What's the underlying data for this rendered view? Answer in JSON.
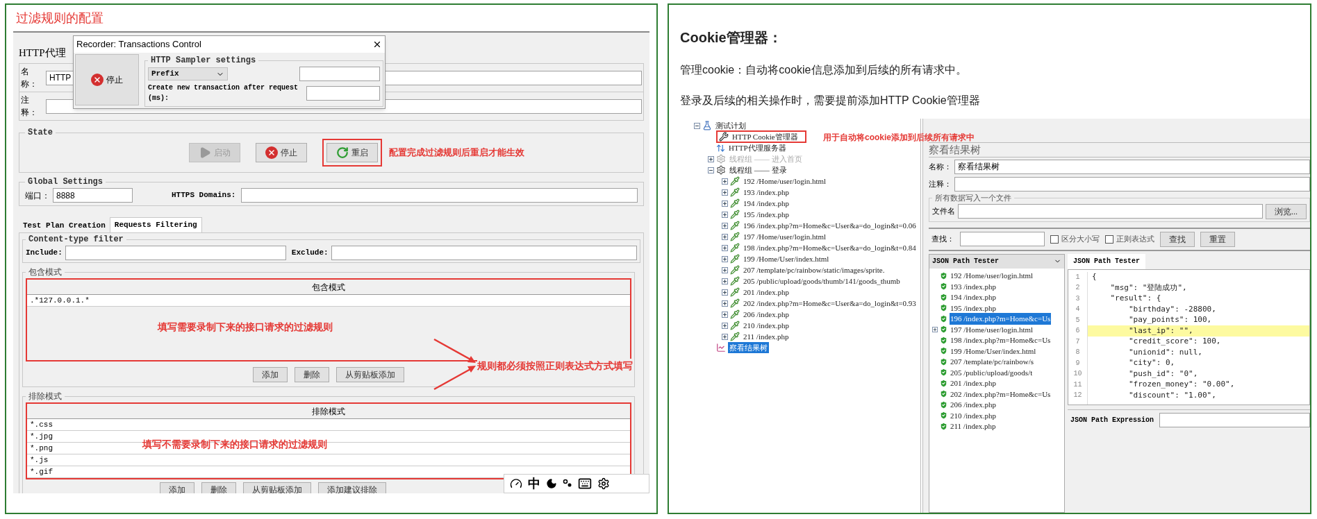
{
  "left": {
    "title": "过滤规则的配置",
    "proxy": {
      "heading": "HTTP代理",
      "name_label": "名称：",
      "name_value": "HTTP",
      "comment_label": "注释："
    },
    "dialog": {
      "title": "Recorder: Transactions Control",
      "stop_label": "停止",
      "group": "HTTP Sampler settings",
      "prefix": "Prefix",
      "transaction_label": "Create new transaction after request (ms):"
    },
    "state": {
      "legend": "State",
      "buttons": [
        {
          "kind": "start",
          "label": "启动",
          "disabled": true,
          "highlighted": false
        },
        {
          "kind": "stop",
          "label": "停止",
          "disabled": false,
          "highlighted": false
        },
        {
          "kind": "restart",
          "label": "重启",
          "disabled": false,
          "highlighted": true
        }
      ],
      "note": "配置完成过滤规则后重启才能生效"
    },
    "global": {
      "legend": "Global Settings",
      "port_label": "端口：",
      "port": "8888",
      "https_label": "HTTPS Domains:"
    },
    "tabs": [
      {
        "label": "Test Plan Creation",
        "selected": false
      },
      {
        "label": "Requests Filtering",
        "selected": true
      }
    ],
    "content_filter": {
      "legend": "Content-type filter",
      "include_label": "Include:",
      "exclude_label": "Exclude:"
    },
    "include": {
      "legend": "包含模式",
      "header": "包含模式",
      "rows": [
        ".*127.0.0.1.*"
      ],
      "note": "填写需要录制下来的接口请求的过滤规则",
      "buttons": [
        "添加",
        "删除",
        "从剪贴板添加"
      ]
    },
    "rule_note": "规则都必须按照正则表达式方式填写",
    "exclude": {
      "legend": "排除模式",
      "header": "排除模式",
      "rows": [
        "*.css",
        "*.jpg",
        "*.png",
        "*.js",
        "*.gif"
      ],
      "note": "填写不需要录制下来的接口请求的过滤规则",
      "buttons": [
        "添加",
        "删除",
        "从剪贴板添加",
        "添加建议排除"
      ]
    },
    "ime": {
      "mode": "中"
    }
  },
  "right": {
    "heading": "Cookie管理器：",
    "paragraphs": [
      "管理cookie：自动将cookie信息添加到后续的所有请求中。",
      "登录及后续的相关操作时，需要提前添加HTTP Cookie管理器"
    ],
    "tree_note": "用于自动将cookie添加到后续所有请求中",
    "tree": [
      {
        "kind": "plan",
        "label": "测试计划",
        "expanded": true,
        "disabled": false,
        "selected": false,
        "boxed": false,
        "children": [
          {
            "kind": "config",
            "label": "HTTP Cookie管理器",
            "disabled": false,
            "selected": false,
            "boxed": true
          },
          {
            "kind": "proxy",
            "label": "HTTP代理服务器",
            "disabled": false,
            "selected": false,
            "boxed": false
          },
          {
            "kind": "thread",
            "label": "线程组 —— 进入首页",
            "expanded": false,
            "disabled": true,
            "selected": false,
            "boxed": false
          },
          {
            "kind": "thread",
            "label": "线程组 —— 登录",
            "expanded": true,
            "disabled": false,
            "selected": false,
            "boxed": false,
            "children": [
              {
                "kind": "sampler",
                "label": "192 /Home/user/login.html",
                "expanded": false,
                "disabled": false,
                "selected": false,
                "boxed": false
              },
              {
                "kind": "sampler",
                "label": "193 /index.php",
                "expanded": false,
                "disabled": false,
                "selected": false,
                "boxed": false
              },
              {
                "kind": "sampler",
                "label": "194 /index.php",
                "expanded": false,
                "disabled": false,
                "selected": false,
                "boxed": false
              },
              {
                "kind": "sampler",
                "label": "195 /index.php",
                "expanded": false,
                "disabled": false,
                "selected": false,
                "boxed": false
              },
              {
                "kind": "sampler",
                "label": "196 /index.php?m=Home&c=User&a=do_login&t=0.06",
                "expanded": false,
                "disabled": false,
                "selected": false,
                "boxed": false
              },
              {
                "kind": "sampler",
                "label": "197 /Home/user/login.html",
                "expanded": false,
                "disabled": false,
                "selected": false,
                "boxed": false
              },
              {
                "kind": "sampler",
                "label": "198 /index.php?m=Home&c=User&a=do_login&t=0.84",
                "expanded": false,
                "disabled": false,
                "selected": false,
                "boxed": false
              },
              {
                "kind": "sampler",
                "label": "199 /Home/User/index.html",
                "expanded": false,
                "disabled": false,
                "selected": false,
                "boxed": false
              },
              {
                "kind": "sampler",
                "label": "207 /template/pc/rainbow/static/images/sprite.",
                "expanded": false,
                "disabled": false,
                "selected": false,
                "boxed": false
              },
              {
                "kind": "sampler",
                "label": "205 /public/upload/goods/thumb/141/goods_thumb",
                "expanded": false,
                "disabled": false,
                "selected": false,
                "boxed": false
              },
              {
                "kind": "sampler",
                "label": "201 /index.php",
                "expanded": false,
                "disabled": false,
                "selected": false,
                "boxed": false
              },
              {
                "kind": "sampler",
                "label": "202 /index.php?m=Home&c=User&a=do_login&t=0.93",
                "expanded": false,
                "disabled": false,
                "selected": false,
                "boxed": false
              },
              {
                "kind": "sampler",
                "label": "206 /index.php",
                "expanded": false,
                "disabled": false,
                "selected": false,
                "boxed": false
              },
              {
                "kind": "sampler",
                "label": "210 /index.php",
                "expanded": false,
                "disabled": false,
                "selected": false,
                "boxed": false
              },
              {
                "kind": "sampler",
                "label": "211 /index.php",
                "expanded": false,
                "disabled": false,
                "selected": false,
                "boxed": false
              }
            ]
          },
          {
            "kind": "listener",
            "label": "察看结果树",
            "disabled": false,
            "selected": true,
            "boxed": false
          }
        ]
      }
    ],
    "results": {
      "title": "察看结果树",
      "name_label": "名称：",
      "name_value": "察看结果树",
      "comment_label": "注释：",
      "file_group": "所有数据写入一个文件",
      "file_label": "文件名",
      "browse": "浏览...",
      "search_label": "查找：",
      "checkboxes": [
        {
          "label": "区分大小写",
          "checked": false
        },
        {
          "label": "正则表达式",
          "checked": false
        }
      ],
      "buttons": [
        "查找",
        "重置"
      ],
      "renderer": "JSON Path Tester",
      "items": [
        {
          "label": "192 /Home/user/login.html",
          "selected": false,
          "expandable": false
        },
        {
          "label": "193 /index.php",
          "selected": false,
          "expandable": false
        },
        {
          "label": "194 /index.php",
          "selected": false,
          "expandable": false
        },
        {
          "label": "195 /index.php",
          "selected": false,
          "expandable": false
        },
        {
          "label": "196 /index.php?m=Home&c=Us",
          "selected": true,
          "expandable": false
        },
        {
          "label": "197 /Home/user/login.html",
          "selected": false,
          "expandable": true
        },
        {
          "label": "198 /index.php?m=Home&c=Us",
          "selected": false,
          "expandable": false
        },
        {
          "label": "199 /Home/User/index.html",
          "selected": false,
          "expandable": false
        },
        {
          "label": "207 /template/pc/rainbow/s",
          "selected": false,
          "expandable": false
        },
        {
          "label": "205 /public/upload/goods/t",
          "selected": false,
          "expandable": false
        },
        {
          "label": "201 /index.php",
          "selected": false,
          "expandable": false
        },
        {
          "label": "202 /index.php?m=Home&c=Us",
          "selected": false,
          "expandable": false
        },
        {
          "label": "206 /index.php",
          "selected": false,
          "expandable": false
        },
        {
          "label": "210 /index.php",
          "selected": false,
          "expandable": false
        },
        {
          "label": "211 /index.php",
          "selected": false,
          "expandable": false
        }
      ],
      "tab": "JSON Path Tester",
      "code": [
        {
          "number": "1",
          "text": "{",
          "highlighted": false
        },
        {
          "number": "2",
          "text": "    \"msg\": \"登陆成功\",",
          "highlighted": false
        },
        {
          "number": "3",
          "text": "    \"result\": {",
          "highlighted": false
        },
        {
          "number": "4",
          "text": "        \"birthday\": -28800,",
          "highlighted": false
        },
        {
          "number": "5",
          "text": "        \"pay_points\": 100,",
          "highlighted": false
        },
        {
          "number": "6",
          "text": "        \"last_ip\": \"\",",
          "highlighted": true
        },
        {
          "number": "7",
          "text": "        \"credit_score\": 100,",
          "highlighted": false
        },
        {
          "number": "8",
          "text": "        \"unionid\": null,",
          "highlighted": false
        },
        {
          "number": "9",
          "text": "        \"city\": 0,",
          "highlighted": false
        },
        {
          "number": "10",
          "text": "        \"push_id\": \"0\",",
          "highlighted": false
        },
        {
          "number": "11",
          "text": "        \"frozen_money\": \"0.00\",",
          "highlighted": false
        },
        {
          "number": "12",
          "text": "        \"discount\": \"1.00\",",
          "highlighted": false
        }
      ],
      "expression_label": "JSON Path Expression"
    }
  }
}
